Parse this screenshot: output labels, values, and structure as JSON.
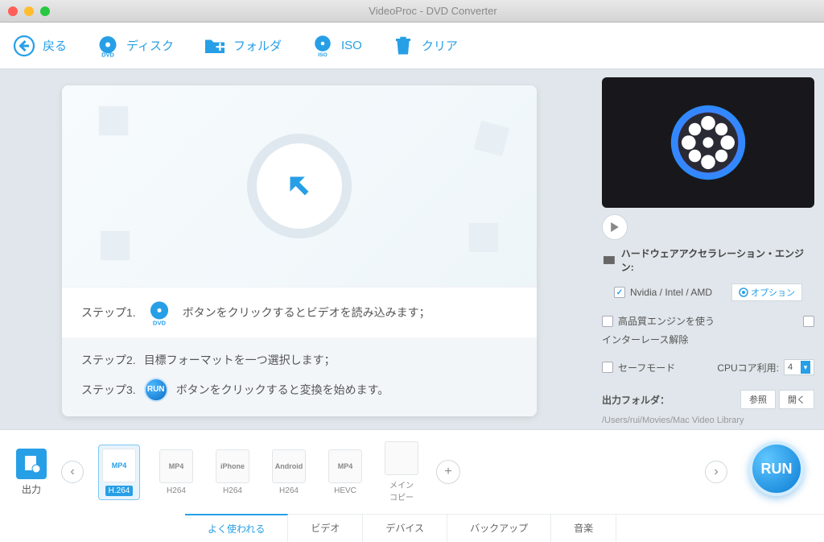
{
  "window": {
    "title": "VideoProc - DVD Converter"
  },
  "toolbar": {
    "back": "戻る",
    "disc": "ディスク",
    "folder": "フォルダ",
    "iso": "ISO",
    "clear": "クリア"
  },
  "steps": {
    "s1_label": "ステップ1.",
    "s1_text": "ボタンをクリックするとビデオを読み込みます；",
    "s2_label": "ステップ2.",
    "s2_text": "目標フォーマットを一つ選択します；",
    "s3_label": "ステップ3.",
    "s3_text": "ボタンをクリックすると変換を始めます。",
    "run_small": "RUN"
  },
  "engine": {
    "title": "ハードウェアアクセラレーション・エンジン:",
    "gpu": "Nvidia /  Intel / AMD",
    "option": "オプション",
    "hq": "高品質エンジンを使う",
    "deint": "インターレース解除",
    "safe": "セーフモード",
    "cpu_label": "CPUコア利用:",
    "cpu_value": "4"
  },
  "output": {
    "folder_label": "出力フォルダ：",
    "browse": "参照",
    "open": "開く",
    "path": "/Users/rui/Movies/Mac Video Library"
  },
  "formats": {
    "output_label": "出力",
    "items": [
      {
        "top": "MP4",
        "bot": "H.264"
      },
      {
        "top": "MP4",
        "bot": "H264"
      },
      {
        "top": "iPhone",
        "bot": "H264"
      },
      {
        "top": "Android",
        "bot": "H264"
      },
      {
        "top": "MP4",
        "bot": "HEVC"
      },
      {
        "top": "",
        "bot": "メイン\nコピー"
      }
    ]
  },
  "tabs": {
    "items": [
      "よく使われる",
      "ビデオ",
      "デバイス",
      "バックアップ",
      "音楽"
    ]
  },
  "run": "RUN"
}
